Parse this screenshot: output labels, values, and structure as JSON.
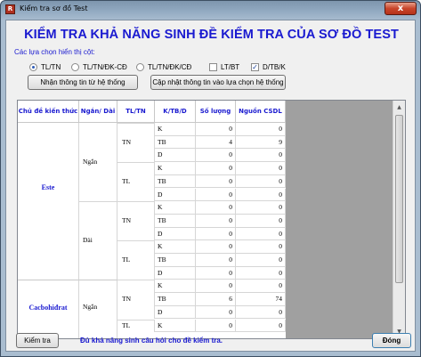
{
  "window": {
    "title": "Kiểm tra sơ đồ Test",
    "icon": "app-icon",
    "close_label": "x"
  },
  "heading": "KIỂM TRA KHẢ NĂNG SINH ĐỀ KIỂM TRA CỦA SƠ ĐỒ TEST",
  "columns_label": "Các lựa chọn hiển thị cột:",
  "options": {
    "radio_tltn": "TL/TN",
    "radio_tltn_dkcd": "TL/TN/ĐK-CĐ",
    "radio_tltn_dk_cd": "TL/TN/ĐK/CĐ",
    "check_ltbt": "LT/BT",
    "check_dtbk": "D/TB/K",
    "selected_radio": "TL/TN",
    "check_ltbt_checked": false,
    "check_dtbk_checked": true
  },
  "buttons": {
    "get_info": "Nhận thông tin từ hệ thống",
    "update_info": "Cập nhật thông tin vào lựa chọn hệ thống",
    "check": "Kiểm tra",
    "close": "Đóng"
  },
  "table": {
    "headers": [
      "Chủ đề kiến thức",
      "Ngắn/ Dài",
      "TL/TN",
      "K/TB/D",
      "Số lượng",
      "Nguồn CSDL"
    ],
    "topics": [
      "Este",
      "Cacbohiđrat"
    ],
    "lengths": [
      "Ngắn",
      "Dài",
      "Ngắn"
    ],
    "types": [
      "TN",
      "TL",
      "TN",
      "TL",
      "TN",
      "TL"
    ],
    "rows": [
      [
        "K",
        "0",
        "0"
      ],
      [
        "TB",
        "4",
        "9"
      ],
      [
        "D",
        "0",
        "0"
      ],
      [
        "K",
        "0",
        "0"
      ],
      [
        "TB",
        "0",
        "0"
      ],
      [
        "D",
        "0",
        "0"
      ],
      [
        "K",
        "0",
        "0"
      ],
      [
        "TB",
        "0",
        "0"
      ],
      [
        "D",
        "0",
        "0"
      ],
      [
        "K",
        "0",
        "0"
      ],
      [
        "TB",
        "0",
        "0"
      ],
      [
        "D",
        "0",
        "0"
      ],
      [
        "K",
        "0",
        "0"
      ],
      [
        "TB",
        "6",
        "74"
      ],
      [
        "D",
        "0",
        "0"
      ],
      [
        "K",
        "0",
        "0"
      ]
    ]
  },
  "status_text": "Đủ khả năng sinh câu hỏi cho đề kiểm tra.",
  "colors": {
    "accent": "#1a1ad0",
    "window_frame": "#8fa7bf",
    "close": "#c9452a"
  }
}
